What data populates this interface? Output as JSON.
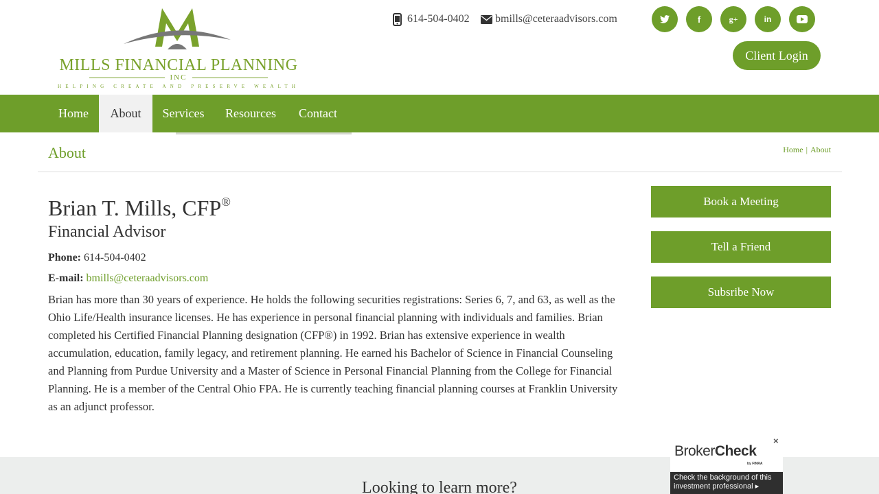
{
  "brand": {
    "name": "MILLS FINANCIAL PLANNING",
    "inc": "INC",
    "tagline": "HELPING CREATE AND PRESERVE WEALTH",
    "color": "#6e9e2a"
  },
  "header": {
    "phone": "614-504-0402",
    "email": "bmills@ceteraadvisors.com",
    "social": [
      {
        "icon": "twitter-icon",
        "glyph": "t"
      },
      {
        "icon": "facebook-icon",
        "glyph": "f"
      },
      {
        "icon": "google-plus-icon",
        "glyph": "g+"
      },
      {
        "icon": "linkedin-icon",
        "glyph": "in"
      },
      {
        "icon": "youtube-icon",
        "glyph": "▶"
      }
    ],
    "client_login": "Client Login"
  },
  "nav": {
    "items": [
      {
        "label": "Home"
      },
      {
        "label": "About",
        "active": true
      },
      {
        "label": "Services"
      },
      {
        "label": "Resources"
      },
      {
        "label": "Contact"
      }
    ]
  },
  "page": {
    "title": "About",
    "breadcrumb": {
      "home": "Home",
      "separator": "|",
      "current": "About"
    }
  },
  "profile": {
    "name": "Brian T. Mills, CFP",
    "name_mark": "®",
    "role": "Financial Advisor",
    "phone_label": "Phone:",
    "phone": "614-504-0402",
    "email_label": "E-mail:",
    "email": "bmills@ceteraadvisors.com",
    "bio": "Brian has more than 30 years of experience. He holds the following securities registrations: Series 6, 7, and 63, as well as the Ohio Life/Health insurance licenses. He has experience in personal financial planning with individuals and families. Brian completed his Certified Financial Planning designation (CFP®) in 1992. Brian has extensive experience in wealth accumulation, education, family legacy, and retirement planning.  He earned his Bachelor of Science in Financial Counseling and Planning from Purdue University and a Master of Science in Personal Financial Planning from the College for Financial Planning. He is a member of the Central Ohio FPA. He is currently teaching financial planning courses at Franklin University as an adjunct professor."
  },
  "sidebar": {
    "buttons": [
      {
        "label": "Book a Meeting"
      },
      {
        "label": "Tell a Friend"
      },
      {
        "label": "Subsribe Now"
      }
    ]
  },
  "footer": {
    "heading": "Looking to learn more?"
  },
  "brokercheck": {
    "logo_part1": "Broker",
    "logo_part2": "Check",
    "by": "by FINRA",
    "close": "×",
    "text": "Check the background of this investment professional",
    "arrow": "▸"
  }
}
